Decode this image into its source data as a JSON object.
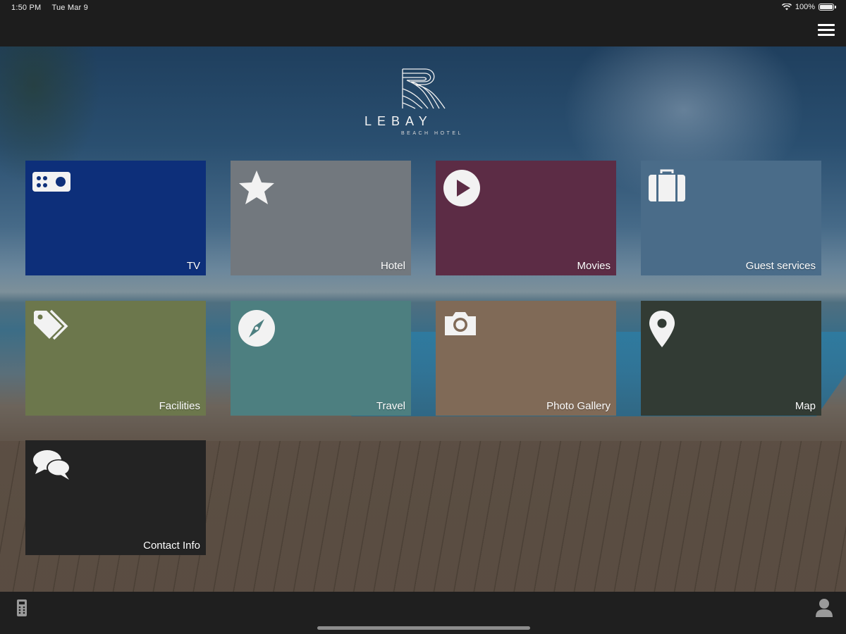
{
  "status_bar": {
    "time": "1:50 PM",
    "date": "Tue Mar 9",
    "battery": "100%"
  },
  "logo": {
    "name": "LEBAY",
    "subtitle": "BEACH HOTEL"
  },
  "tiles": [
    {
      "label": "TV",
      "icon": "tv-remote-icon",
      "color": "#0d2f7a"
    },
    {
      "label": "Hotel",
      "icon": "star-icon",
      "color": "#72787e"
    },
    {
      "label": "Movies",
      "icon": "play-icon",
      "color": "#5c2c45"
    },
    {
      "label": "Guest services",
      "icon": "briefcase-icon",
      "color": "#4a6c89"
    },
    {
      "label": "Facilities",
      "icon": "tags-icon",
      "color": "#6c774c"
    },
    {
      "label": "Travel",
      "icon": "compass-icon",
      "color": "#4d7f80"
    },
    {
      "label": "Photo Gallery",
      "icon": "camera-icon",
      "color": "#806a57"
    },
    {
      "label": "Map",
      "icon": "map-pin-icon",
      "color": "#323b34"
    },
    {
      "label": "Contact Info",
      "icon": "chat-bubbles-icon",
      "color": "#232323"
    }
  ]
}
